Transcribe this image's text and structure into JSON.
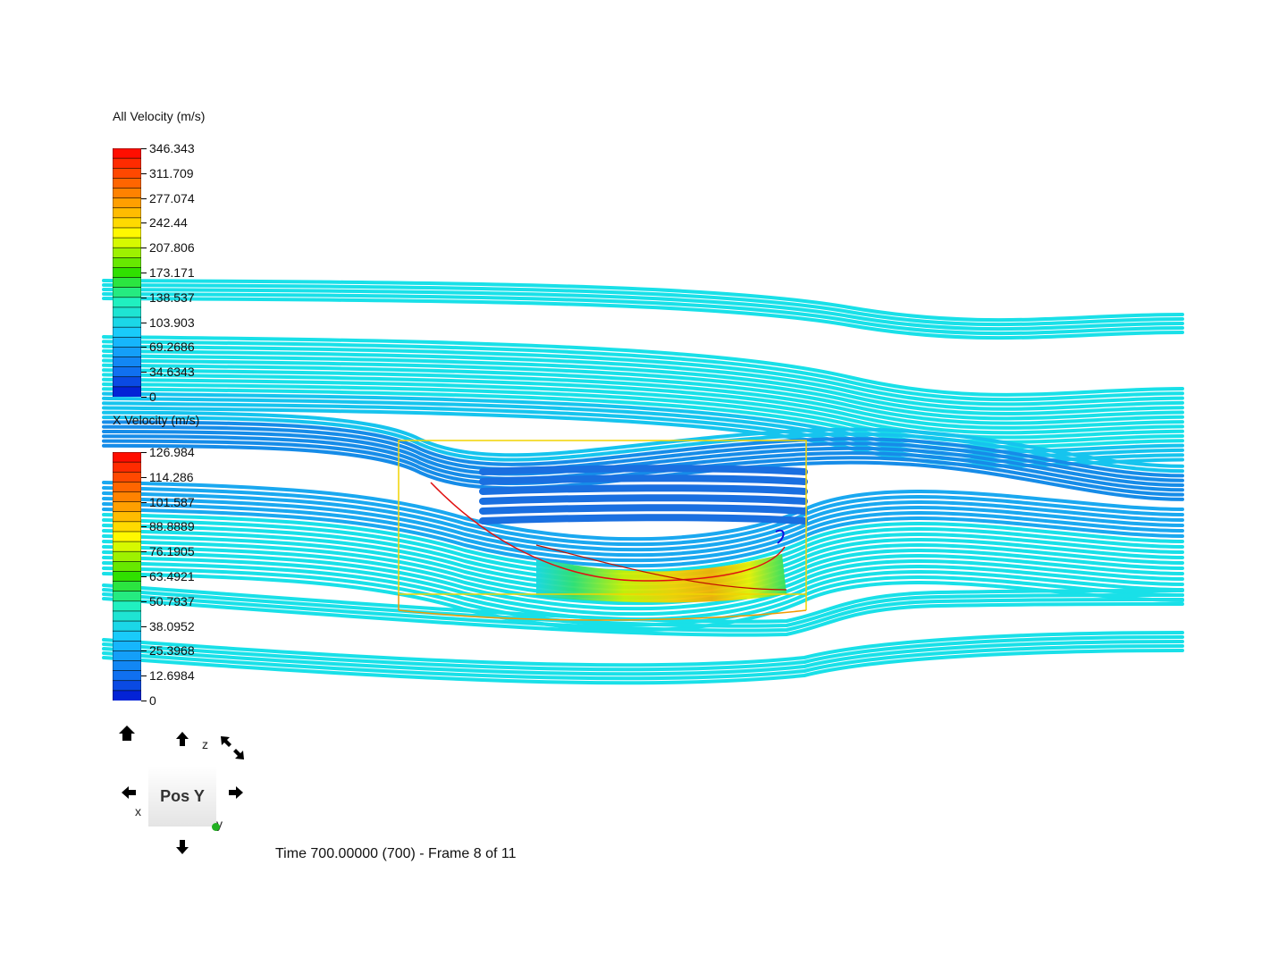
{
  "legends": [
    {
      "title": "All Velocity (m/s)",
      "ticks": [
        "346.343",
        "311.709",
        "277.074",
        "242.44",
        "207.806",
        "173.171",
        "138.537",
        "103.903",
        "69.2686",
        "34.6343",
        "0"
      ]
    },
    {
      "title": "X Velocity (m/s)",
      "ticks": [
        "126.984",
        "114.286",
        "101.587",
        "88.8889",
        "76.1905",
        "63.4921",
        "50.7937",
        "38.0952",
        "25.3968",
        "12.6984",
        "0"
      ]
    }
  ],
  "view_cube": {
    "face_label": "Pos Y",
    "axis_z": "z",
    "axis_x": "x",
    "axis_y": "y"
  },
  "navigation": {
    "home_icon": "home-icon",
    "rotate_up_icon": "arrow-up-icon",
    "rotate_down_icon": "arrow-down-icon",
    "rotate_left_icon": "arrow-left-icon",
    "rotate_right_icon": "arrow-right-icon",
    "roll_icon": "roll-arrows-icon"
  },
  "status": {
    "time_text": "Time 700.00000 (700) - Frame 8 of 11"
  },
  "colors": {
    "stream_cyan": "#19e0e8",
    "stream_blue": "#1a6fe0",
    "fast_yellow": "#f2f000",
    "fast_red": "#ff2a00",
    "box_yellow": "#f2c600",
    "box_orange": "#f29400"
  }
}
